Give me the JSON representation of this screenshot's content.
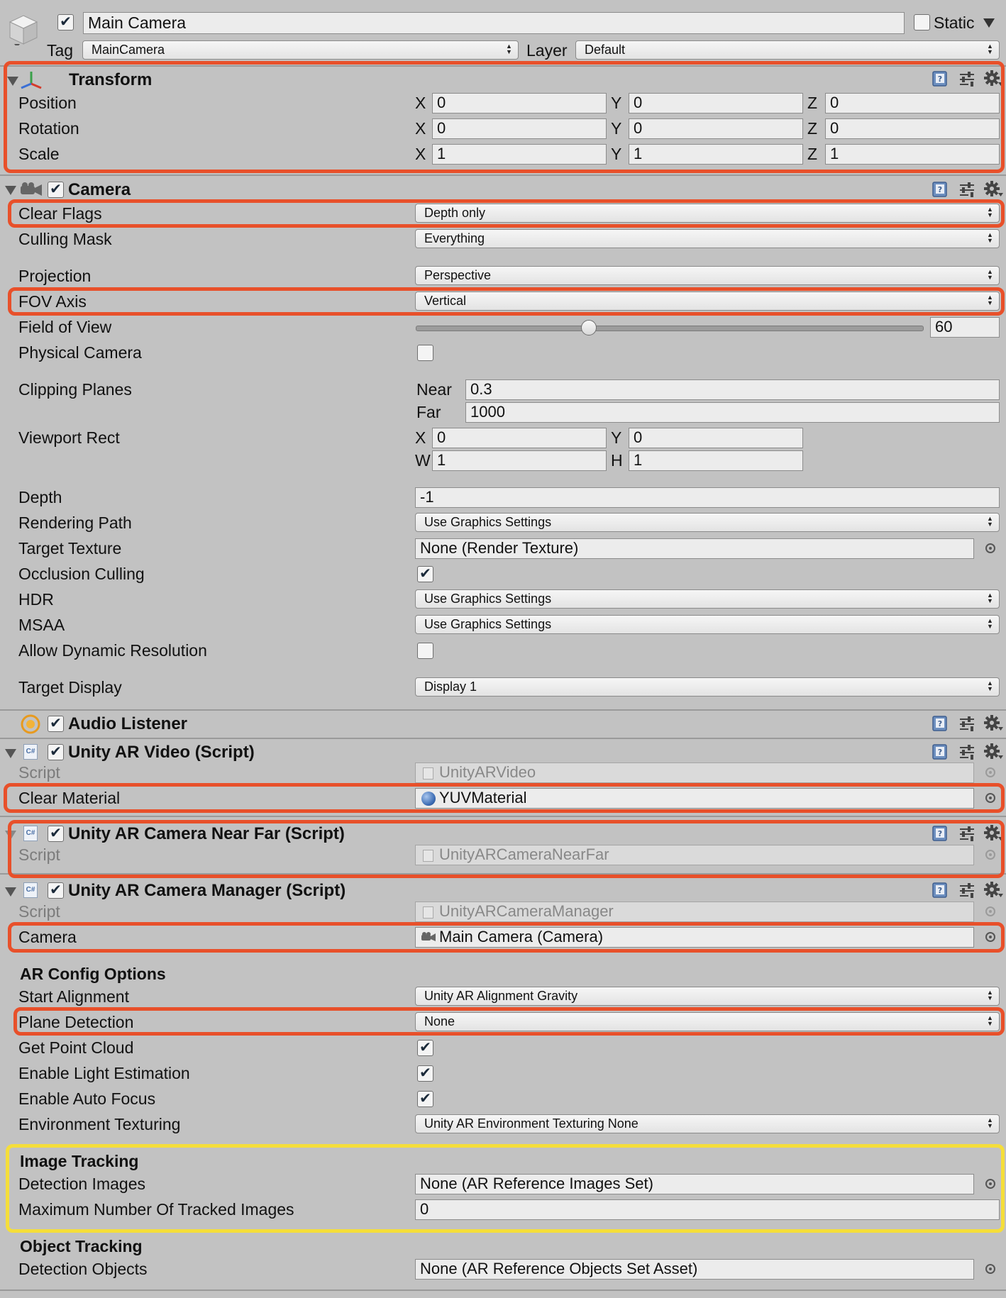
{
  "header": {
    "object_name": "Main Camera",
    "active": true,
    "static_label": "Static",
    "static_checked": false,
    "tag_label": "Tag",
    "tag_value": "MainCamera",
    "layer_label": "Layer",
    "layer_value": "Default"
  },
  "transform": {
    "title": "Transform",
    "rows": [
      {
        "label": "Position",
        "x": "0",
        "y": "0",
        "z": "0"
      },
      {
        "label": "Rotation",
        "x": "0",
        "y": "0",
        "z": "0"
      },
      {
        "label": "Scale",
        "x": "1",
        "y": "1",
        "z": "1"
      }
    ],
    "axis": {
      "x": "X",
      "y": "Y",
      "z": "Z"
    }
  },
  "camera": {
    "title": "Camera",
    "enabled": true,
    "clear_flags": {
      "label": "Clear Flags",
      "value": "Depth only"
    },
    "culling_mask": {
      "label": "Culling Mask",
      "value": "Everything"
    },
    "projection": {
      "label": "Projection",
      "value": "Perspective"
    },
    "fov_axis": {
      "label": "FOV Axis",
      "value": "Vertical"
    },
    "field_of_view": {
      "label": "Field of View",
      "value": "60",
      "slider_fraction": 0.34
    },
    "physical_camera": {
      "label": "Physical Camera",
      "checked": false
    },
    "clipping": {
      "label": "Clipping Planes",
      "near_label": "Near",
      "near": "0.3",
      "far_label": "Far",
      "far": "1000"
    },
    "viewport": {
      "label": "Viewport Rect",
      "x_label": "X",
      "x": "0",
      "y_label": "Y",
      "y": "0",
      "w_label": "W",
      "w": "1",
      "h_label": "H",
      "h": "1"
    },
    "depth": {
      "label": "Depth",
      "value": "-1"
    },
    "rendering_path": {
      "label": "Rendering Path",
      "value": "Use Graphics Settings"
    },
    "target_texture": {
      "label": "Target Texture",
      "value": "None (Render Texture)"
    },
    "occlusion_culling": {
      "label": "Occlusion Culling",
      "checked": true
    },
    "hdr": {
      "label": "HDR",
      "value": "Use Graphics Settings"
    },
    "msaa": {
      "label": "MSAA",
      "value": "Use Graphics Settings"
    },
    "allow_dynamic_resolution": {
      "label": "Allow Dynamic Resolution",
      "checked": false
    },
    "target_display": {
      "label": "Target Display",
      "value": "Display 1"
    }
  },
  "audio_listener": {
    "title": "Audio Listener",
    "enabled": true
  },
  "ar_video": {
    "title": "Unity AR Video (Script)",
    "enabled": true,
    "script_label": "Script",
    "script_value": "UnityARVideo",
    "clear_material_label": "Clear Material",
    "clear_material_value": "YUVMaterial"
  },
  "ar_near_far": {
    "title": "Unity AR Camera Near Far (Script)",
    "enabled": true,
    "script_label": "Script",
    "script_value": "UnityARCameraNearFar"
  },
  "ar_manager": {
    "title": "Unity AR Camera Manager (Script)",
    "enabled": true,
    "script_label": "Script",
    "script_value": "UnityARCameraManager",
    "camera_label": "Camera",
    "camera_value": "Main Camera (Camera)",
    "config_heading": "AR Config Options",
    "start_alignment": {
      "label": "Start Alignment",
      "value": "Unity AR Alignment Gravity"
    },
    "plane_detection": {
      "label": "Plane Detection",
      "value": "None"
    },
    "get_point_cloud": {
      "label": "Get Point Cloud",
      "checked": true
    },
    "light_estimation": {
      "label": "Enable Light Estimation",
      "checked": true
    },
    "auto_focus": {
      "label": "Enable Auto Focus",
      "checked": true
    },
    "env_texturing": {
      "label": "Environment Texturing",
      "value": "Unity AR Environment Texturing None"
    },
    "image_tracking_heading": "Image Tracking",
    "detection_images": {
      "label": "Detection Images",
      "value": "None (AR Reference Images Set)"
    },
    "max_tracked_images": {
      "label": "Maximum Number Of Tracked Images",
      "value": "0"
    },
    "object_tracking_heading": "Object Tracking",
    "detection_objects": {
      "label": "Detection Objects",
      "value": "None (AR Reference Objects Set Asset)"
    }
  },
  "colors": {
    "highlight_red": "#e8502a",
    "highlight_yellow": "#f5de3a",
    "panel_bg": "#c2c2c2"
  }
}
